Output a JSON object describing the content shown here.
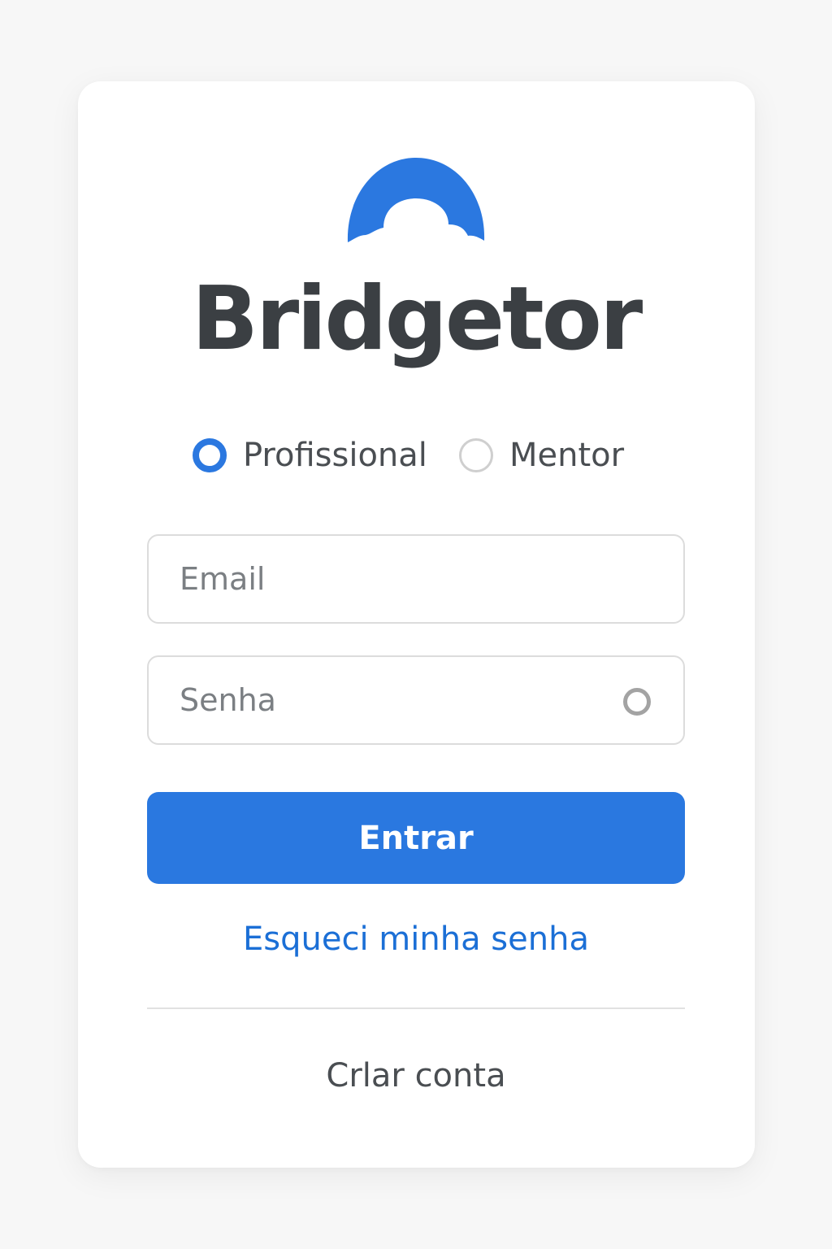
{
  "brand": {
    "name": "Bridgetor",
    "logo_icon": "arch-logo-icon",
    "accent_color": "#2b78e0"
  },
  "role_selector": {
    "options": [
      {
        "label": "Profissional",
        "selected": true
      },
      {
        "label": "Mentor",
        "selected": false
      }
    ]
  },
  "form": {
    "email": {
      "placeholder": "Email",
      "value": ""
    },
    "password": {
      "placeholder": "Senha",
      "value": "",
      "toggle_icon": "show-password-icon"
    },
    "submit_label": "Entrar",
    "forgot_link": "Esqueci minha senha",
    "create_account": "Crlar conta"
  }
}
